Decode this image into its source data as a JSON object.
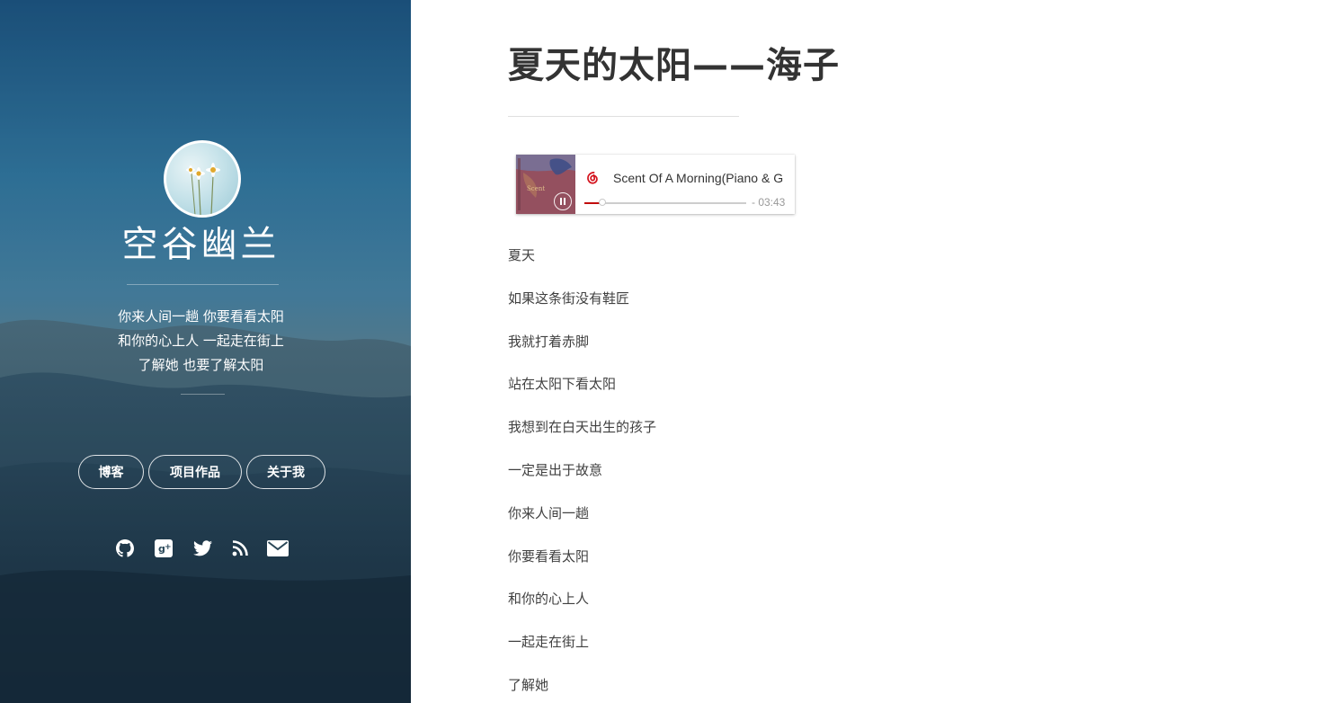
{
  "sidebar": {
    "title": "空谷幽兰",
    "tagline": [
      "你来人间一趟 你要看看太阳",
      "和你的心上人 一起走在街上",
      "了解她 也要了解太阳"
    ],
    "nav": [
      {
        "label": "博客"
      },
      {
        "label": "项目作品"
      },
      {
        "label": "关于我"
      }
    ],
    "social_icons": [
      "github-icon",
      "google-plus-icon",
      "twitter-icon",
      "rss-icon",
      "email-icon"
    ]
  },
  "post": {
    "title": "夏天的太阳——海子",
    "player": {
      "track": "Scent Of A Morning(Piano & G",
      "time": "- 03:43",
      "progress": 0.11,
      "state_icon": "pause-icon"
    },
    "lyrics": [
      "夏天",
      "如果这条街没有鞋匠",
      "我就打着赤脚",
      "站在太阳下看太阳",
      "我想到在白天出生的孩子",
      "一定是出于故意",
      "你来人间一趟",
      "你要看看太阳",
      "和你的心上人",
      "一起走在街上",
      "了解她"
    ]
  },
  "colors": {
    "accent": "#c20c0c",
    "text": "#333333",
    "sidebar_text": "#ffffff"
  }
}
